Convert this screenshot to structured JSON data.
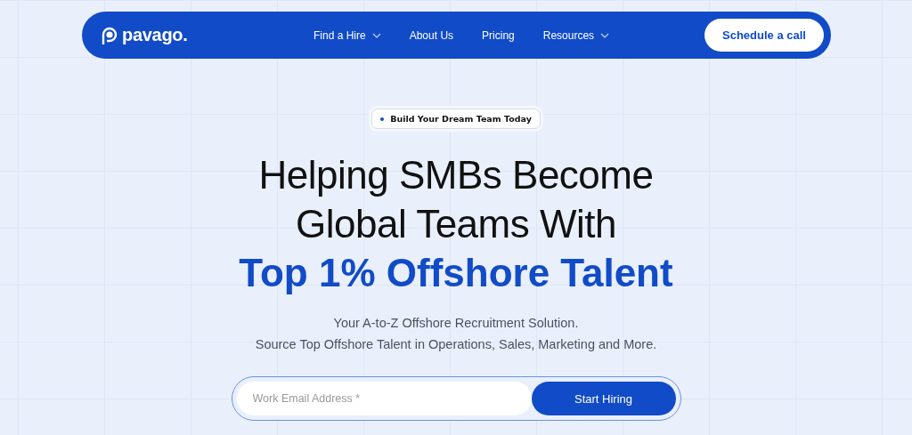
{
  "nav": {
    "logo": "pavago.",
    "items": [
      {
        "label": "Find a Hire",
        "dropdown": true
      },
      {
        "label": "About Us",
        "dropdown": false
      },
      {
        "label": "Pricing",
        "dropdown": false
      },
      {
        "label": "Resources",
        "dropdown": true
      }
    ],
    "cta": "Schedule a call"
  },
  "hero": {
    "badge": "Build Your Dream Team Today",
    "headline": [
      "Helping SMBs Become",
      "Global Teams With"
    ],
    "highlight": "Top 1% Offshore Talent",
    "subtitle": [
      "Your A-to-Z Offshore Recruitment Solution.",
      "Source Top Offshore Talent in Operations, Sales, Marketing and More."
    ],
    "email": {
      "placeholder": "Work Email Address *"
    },
    "submit": "Start Hiring"
  }
}
